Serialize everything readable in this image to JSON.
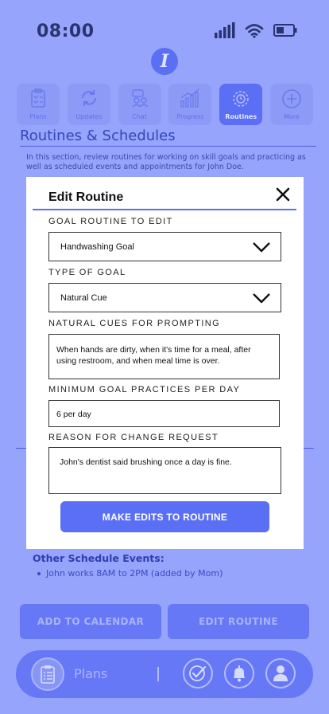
{
  "status": {
    "time": "08:00"
  },
  "app": {
    "logo_letter": "I"
  },
  "nav": {
    "tabs": [
      {
        "label": "Plans",
        "icon": "clipboard-icon"
      },
      {
        "label": "Updates",
        "icon": "refresh-icon"
      },
      {
        "label": "Chat",
        "icon": "chat-icon"
      },
      {
        "label": "Progress",
        "icon": "chart-icon"
      },
      {
        "label": "Routines",
        "icon": "gear-clock-icon",
        "active": true
      },
      {
        "label": "More",
        "icon": "plus-circle-icon"
      }
    ]
  },
  "page": {
    "title": "Routines & Schedules",
    "intro": "In this section, review routines for working on skill goals and practicing as well as scheduled events and appointments for John Doe."
  },
  "modal": {
    "title": "Edit Routine",
    "fields": {
      "goal_routine": {
        "label": "GOAL ROUTINE TO EDIT",
        "value": "Handwashing Goal"
      },
      "goal_type": {
        "label": "TYPE OF GOAL",
        "value": "Natural Cue"
      },
      "natural_cues": {
        "label": "NATURAL CUES FOR PROMPTING",
        "value": "When hands are dirty, when it's time for a meal, after using restroom, and when meal time is over."
      },
      "min_practices": {
        "label": "MINIMUM GOAL PRACTICES PER DAY",
        "value": "6 per day"
      },
      "reason": {
        "label": "REASON FOR CHANGE REQUEST",
        "value": "John's dentist said brushing once a day is fine."
      }
    },
    "submit_label": "MAKE EDITS TO ROUTINE"
  },
  "events": {
    "heading": "Other Schedule Events:",
    "items": [
      "John works 8AM to 2PM (added by Mom)"
    ]
  },
  "actions": {
    "add_calendar": "ADD TO CALENDAR",
    "edit_routine": "EDIT ROUTINE"
  },
  "tabbar": {
    "plans_label": "Plans"
  },
  "colors": {
    "accent": "#5b6ff5",
    "background": "#97a4fb",
    "modal_bg": "#ffffff"
  }
}
